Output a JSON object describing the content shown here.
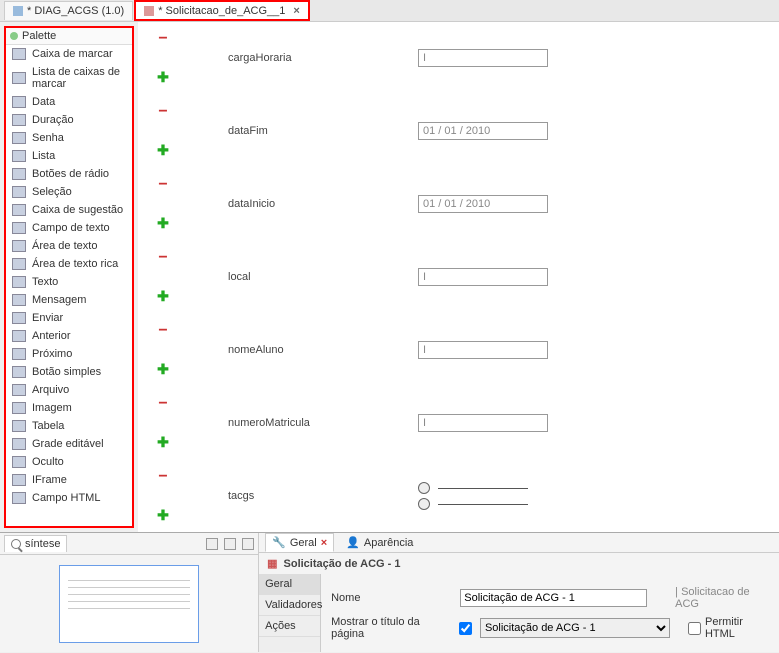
{
  "tabs": [
    {
      "label": "* DIAG_ACGS (1.0)",
      "active": false
    },
    {
      "label": "* Solicitacao_de_ACG__1",
      "active": true
    }
  ],
  "palette": {
    "header": "Palette",
    "items": [
      {
        "label": "Caixa de marcar"
      },
      {
        "label": "Lista de caixas de marcar"
      },
      {
        "label": "Data"
      },
      {
        "label": "Duração"
      },
      {
        "label": "Senha"
      },
      {
        "label": "Lista"
      },
      {
        "label": "Botões de rádio"
      },
      {
        "label": "Seleção"
      },
      {
        "label": "Caixa de sugestão"
      },
      {
        "label": "Campo de texto"
      },
      {
        "label": "Área de texto"
      },
      {
        "label": "Área de texto rica"
      },
      {
        "label": "Texto"
      },
      {
        "label": "Mensagem"
      },
      {
        "label": "Enviar"
      },
      {
        "label": "Anterior"
      },
      {
        "label": "Próximo"
      },
      {
        "label": "Botão simples"
      },
      {
        "label": "Arquivo"
      },
      {
        "label": "Imagem"
      },
      {
        "label": "Tabela"
      },
      {
        "label": "Grade editável"
      },
      {
        "label": "Oculto"
      },
      {
        "label": "IFrame"
      },
      {
        "label": "Campo HTML"
      }
    ]
  },
  "form_fields": [
    {
      "label": "cargaHoraria",
      "value": "I",
      "type": "text"
    },
    {
      "label": "dataFim",
      "value": "01 / 01 / 2010",
      "type": "text"
    },
    {
      "label": "dataInicio",
      "value": "01 / 01 / 2010",
      "type": "text"
    },
    {
      "label": "local",
      "value": "I",
      "type": "text"
    },
    {
      "label": "nomeAluno",
      "value": "I",
      "type": "text"
    },
    {
      "label": "numeroMatricula",
      "value": "I",
      "type": "text"
    },
    {
      "label": "tacgs",
      "value": "",
      "type": "radio"
    }
  ],
  "minimap_tab": "síntese",
  "props": {
    "tabs": [
      {
        "label": "Geral",
        "active": true
      },
      {
        "label": "Aparência",
        "active": false
      }
    ],
    "title": "Solicitação de ACG - 1",
    "side_tabs": [
      "Geral",
      "Validadores",
      "Ações"
    ],
    "rows": {
      "nome_label": "Nome",
      "nome_value": "Solicitação de ACG - 1",
      "nome_hint": "Solicitacao de ACG",
      "mostrar_label": "Mostrar o título da página",
      "mostrar_value": "Solicitação de ACG - 1",
      "permitir_label": "Permitir HTML"
    }
  }
}
